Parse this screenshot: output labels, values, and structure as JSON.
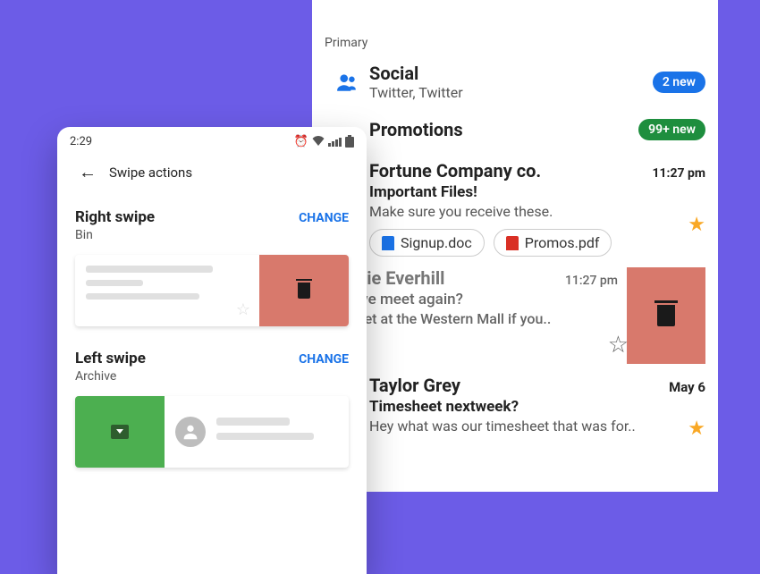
{
  "right": {
    "inbox_label": "Primary",
    "social": {
      "title": "Social",
      "sub": "Twitter, Twitter",
      "badge": "2 new"
    },
    "promotions": {
      "title": "Promotions",
      "badge": "99+ new"
    },
    "emails": [
      {
        "sender": "Fortune Company co.",
        "time": "11:27 pm",
        "subject": "Important Files!",
        "preview": "Make sure you receive these.",
        "attachments": [
          {
            "name": "Signup.doc",
            "color": "blue"
          },
          {
            "name": "Promos.pdf",
            "color": "red"
          }
        ]
      },
      {
        "sender": "hie Everhill",
        "time": "11:27 pm",
        "subject": "we meet again?",
        "preview": "eet at the Western Mall if you.."
      },
      {
        "sender": "Taylor Grey",
        "time": "May 6",
        "subject": "Timesheet nextweek?",
        "preview": "Hey what was our timesheet that was for.."
      }
    ]
  },
  "left": {
    "time": "2:29",
    "title": "Swipe actions",
    "right_swipe": {
      "title": "Right swipe",
      "sub": "Bin",
      "change": "CHANGE"
    },
    "left_swipe": {
      "title": "Left swipe",
      "sub": "Archive",
      "change": "CHANGE"
    }
  }
}
